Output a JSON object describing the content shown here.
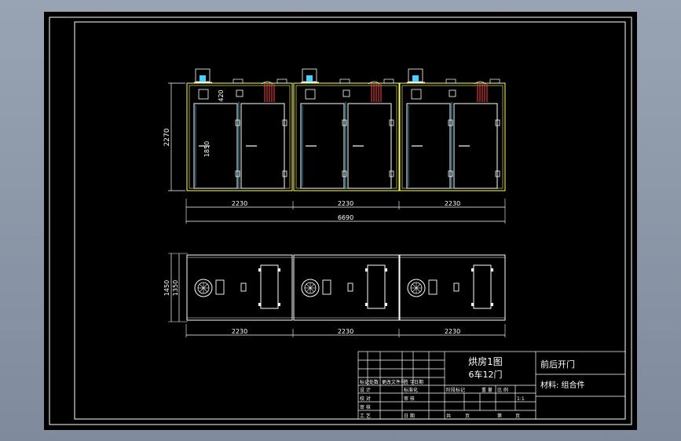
{
  "drawing": {
    "front_view": {
      "height_dim": "2270",
      "door_height_dim": "1850",
      "fan_gap_dim": "420",
      "module_widths": [
        "2230",
        "2230",
        "2230"
      ],
      "overall_width": "6690"
    },
    "top_view": {
      "depth_outer": "1450",
      "depth_inner": "1350",
      "module_widths": [
        "2230",
        "2230",
        "2230"
      ]
    },
    "title_block": {
      "title_line1": "烘房1图",
      "title_line2": "6车12门",
      "part_name": "前后开门",
      "material": "材料: 组合件",
      "small_labels": [
        "标记",
        "处数",
        "更改文件号",
        "签 字",
        "日期",
        "设 计",
        "标准化",
        "校 对",
        "审 核",
        "审 核",
        "工 艺",
        "日 期",
        "阶段标记",
        "重 量",
        "比 例",
        "1:1",
        "共",
        "页",
        "第",
        "页"
      ]
    }
  },
  "colors": {
    "background": "#000000",
    "cabinet_outline": "#ffff66",
    "door": "#ffffff",
    "hinge_line": "#4ad0ff",
    "heater": "#ff4444",
    "dimension": "#ffffff"
  }
}
